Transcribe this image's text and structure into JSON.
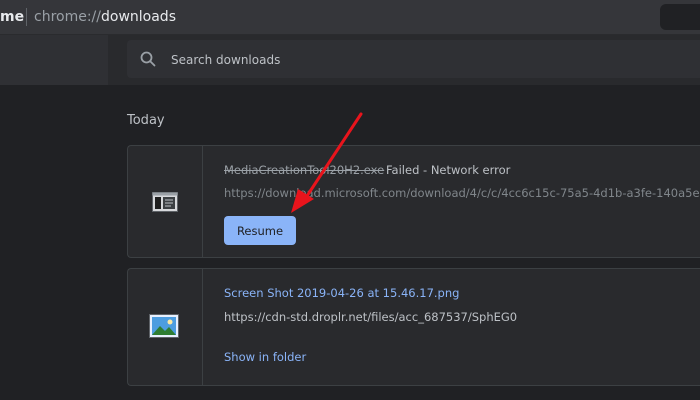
{
  "addressbar": {
    "tab_fragment": "me",
    "url_scheme": "chrome://",
    "url_host": "downloads"
  },
  "search": {
    "placeholder": "Search downloads",
    "value": ""
  },
  "section": {
    "title": "Today"
  },
  "downloads": [
    {
      "file_name": "MediaCreationTool20H2.exe",
      "status": "Failed - Network error",
      "url": "https://download.microsoft.com/download/4/c/c/4cc6c15c-75a5-4d1b-a3fe-140a5e...",
      "action_label": "Resume",
      "icon": "exe-file-icon"
    },
    {
      "file_name": "Screen Shot 2019-04-26 at 15.46.17.png",
      "url": "https://cdn-std.droplr.net/files/acc_687537/SphEG0",
      "action_label": "Show in folder",
      "icon": "image-file-icon"
    }
  ],
  "colors": {
    "background": "#202124",
    "card": "#292a2d",
    "accent": "#8ab4f8",
    "annotation_arrow": "#e8141c"
  }
}
